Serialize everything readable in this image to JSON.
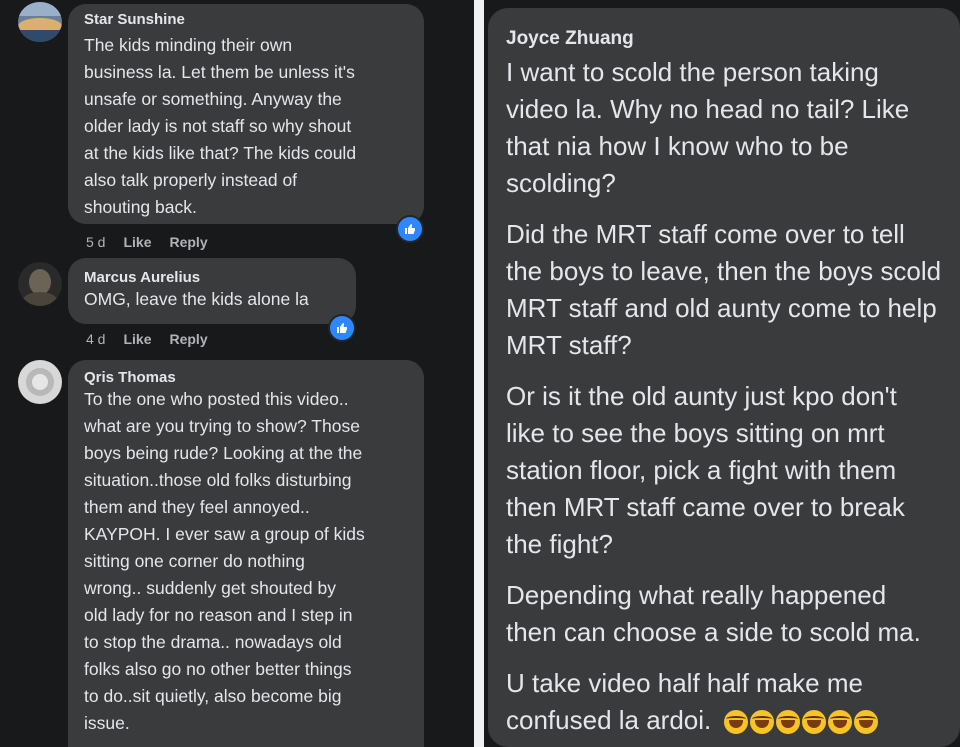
{
  "comments": [
    {
      "author": "Star Sunshine",
      "text": "The kids minding their own\nbusiness la. Let them be unless it's\nunsafe or something. Anyway the\nolder lady is not staff so why shout\nat the kids like that? The kids could\nalso talk properly instead of\nshouting back.",
      "time": "5 d",
      "like": "Like",
      "reply": "Reply"
    },
    {
      "author": "Marcus Aurelius",
      "text": "OMG, leave the kids alone la",
      "time": "4 d",
      "like": "Like",
      "reply": "Reply"
    },
    {
      "author": "Qris Thomas",
      "text": "To the one who posted this video..\nwhat are you trying to show? Those\nboys being rude? Looking at the the\nsituation..those old folks disturbing\nthem and they feel annoyed..\nKAYPOH. I ever saw a group of kids\nsitting one corner do nothing\nwrong.. suddenly get shouted by\nold lady for no reason and I step in\nto stop the drama.. nowadays old\nfolks also go no other better things\nto do..sit quietly, also become big\nissue."
    }
  ],
  "right_comment": {
    "author": "Joyce Zhuang",
    "paragraphs": [
      "I want to scold the person taking video la. Why no head no tail? Like that nia how I know who to be scolding?",
      "Did the MRT staff come over to tell the boys to leave, then the boys scold MRT staff and old aunty come to help MRT staff?",
      "Or is it the old aunty just kpo don't like to see the boys sitting on mrt station floor, pick a fight with them then MRT staff came over to break the fight?",
      "Depending what really happened then can choose a side to scold ma.",
      "U take video half half make me confused la ardoi."
    ],
    "emoji_count": 6,
    "emoji_name": "rolling-on-floor-laughing-emoji"
  },
  "colors": {
    "background": "#18191a",
    "bubble": "#3a3b3c",
    "text": "#e4e6eb",
    "meta": "#b0b3b8",
    "like_blue": "#2d88ff",
    "divider": "#f0f2f5"
  }
}
